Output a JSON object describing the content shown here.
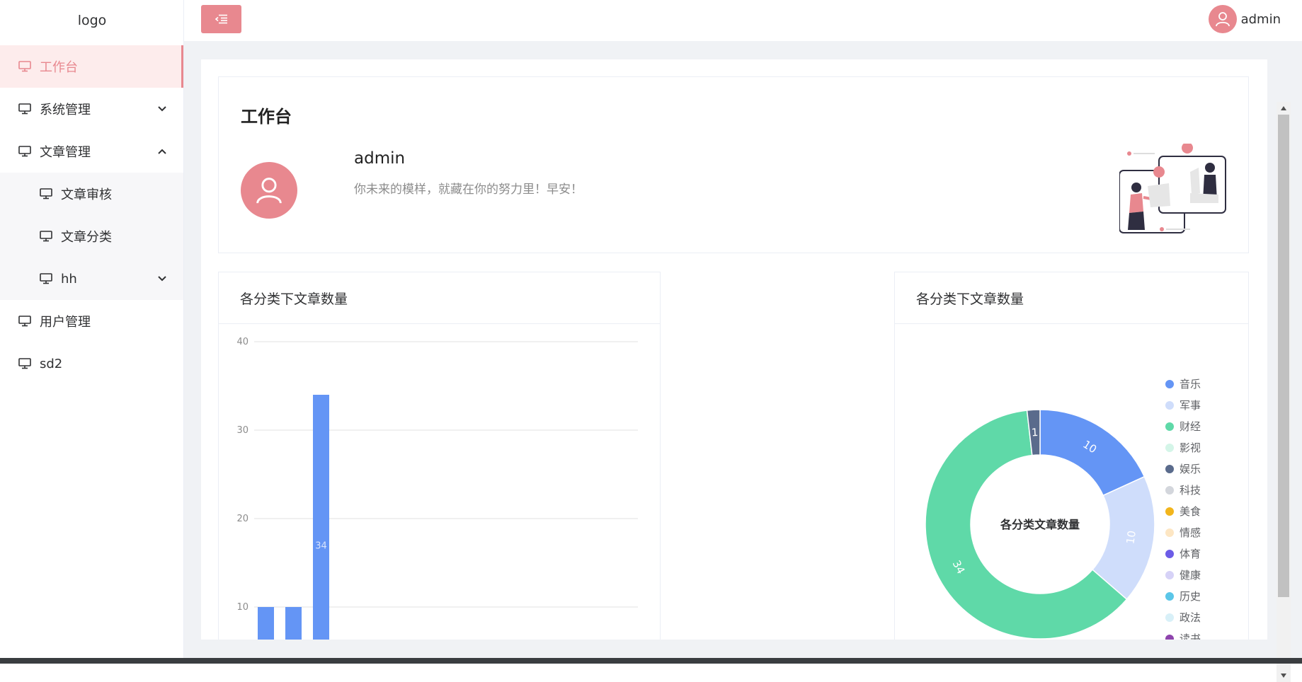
{
  "app": {
    "logo": "logo"
  },
  "header": {
    "user_name": "admin"
  },
  "sidebar": {
    "items": [
      {
        "label": "工作台",
        "active": true
      },
      {
        "label": "系统管理",
        "expandable": true,
        "expanded": false
      },
      {
        "label": "文章管理",
        "expandable": true,
        "expanded": true,
        "children": [
          {
            "label": "文章审核"
          },
          {
            "label": "文章分类"
          },
          {
            "label": "hh",
            "expandable": true,
            "expanded": false
          }
        ]
      },
      {
        "label": "用户管理"
      },
      {
        "label": "sd2"
      }
    ]
  },
  "welcome": {
    "title": "工作台",
    "user_name": "admin",
    "greeting": "你未来的模样，就藏在你的努力里！早安！"
  },
  "bar_card": {
    "title": "各分类下文章数量"
  },
  "pie_card": {
    "title": "各分类下文章数量"
  },
  "colors": {
    "accent": "#e8888f",
    "bar": "#6495f5"
  },
  "chart_data": [
    {
      "type": "bar",
      "title": "",
      "categories": [
        "",
        "",
        ""
      ],
      "values": [
        10,
        10,
        34
      ],
      "ylim": [
        0,
        40
      ],
      "yticks": [
        10,
        20,
        30,
        40
      ],
      "grid": true,
      "data_labels": true
    },
    {
      "type": "pie",
      "variant": "donut",
      "center_label": "各分类文章数量",
      "legend_position": "right",
      "slices": [
        {
          "name": "音乐",
          "value": 10,
          "color": "#6495f5"
        },
        {
          "name": "军事",
          "value": 10,
          "color": "#cfddfb"
        },
        {
          "name": "财经",
          "value": 34,
          "color": "#5fd9a8"
        },
        {
          "name": "影视",
          "value": 0,
          "color": "#d4f5e8"
        },
        {
          "name": "娱乐",
          "value": 1,
          "color": "#5a6b8c"
        },
        {
          "name": "科技",
          "value": 0,
          "color": "#d3d6dc"
        },
        {
          "name": "美食",
          "value": 0,
          "color": "#f2b51c"
        },
        {
          "name": "情感",
          "value": 0,
          "color": "#fde6c3"
        },
        {
          "name": "体育",
          "value": 0,
          "color": "#6c5ce7"
        },
        {
          "name": "健康",
          "value": 0,
          "color": "#d6d2f7"
        },
        {
          "name": "历史",
          "value": 0,
          "color": "#5bc6e8"
        },
        {
          "name": "政法",
          "value": 0,
          "color": "#d8f0f8"
        },
        {
          "name": "读书",
          "value": 0,
          "color": "#8e44ad"
        }
      ]
    }
  ]
}
